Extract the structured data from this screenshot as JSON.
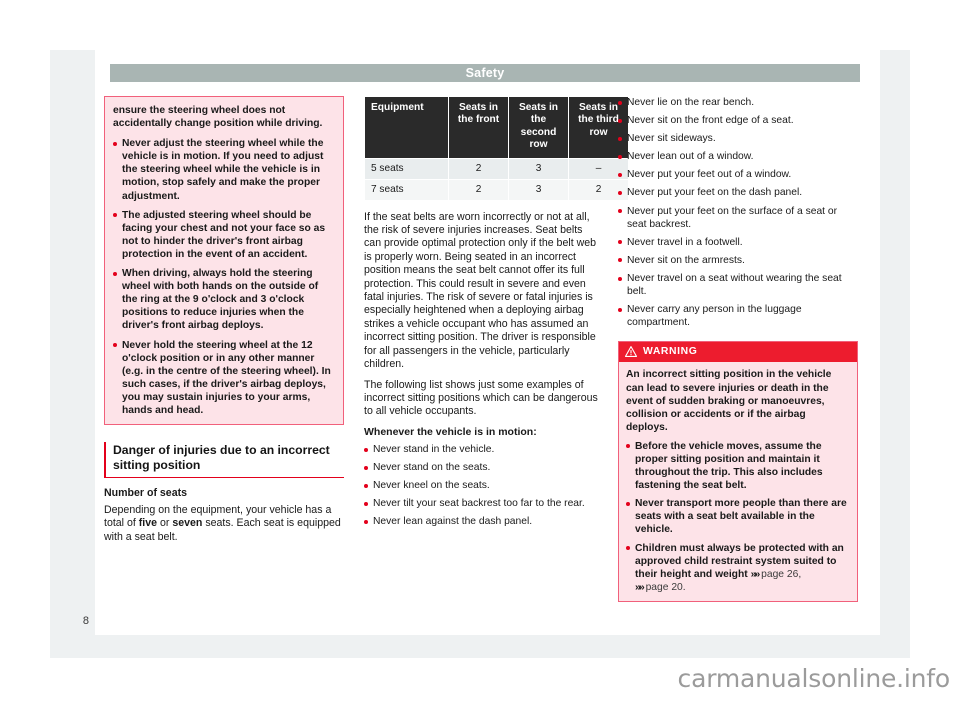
{
  "header": {
    "title": "Safety"
  },
  "page_number": "8",
  "watermark": "carmanualsonline.info",
  "left_column": {
    "danger_box": {
      "intro": "ensure the steering wheel does not accidentally change position while driving.",
      "bullets": [
        "Never adjust the steering wheel while the vehicle is in motion. If you need to adjust the steering wheel while the vehicle is in motion, stop safely and make the proper adjustment.",
        "The adjusted steering wheel should be facing your chest and not your face so as not to hinder the driver's front airbag protection in the event of an accident.",
        "When driving, always hold the steering wheel with both hands on the outside of the ring at the 9 o'clock and 3 o'clock positions to reduce injuries when the driver's front airbag deploys.",
        "Never hold the steering wheel at the 12 o'clock position or in any other manner (e.g. in the centre of the steering wheel). In such cases, if the driver's airbag deploys, you may sustain injuries to your arms, hands and head."
      ]
    },
    "section_heading": "Danger of injuries due to an incorrect sitting position",
    "sub_heading": "Number of seats",
    "paragraph_pre": "Depending on the equipment, your vehicle has a total of ",
    "paragraph_bold1": "five",
    "paragraph_mid": " or ",
    "paragraph_bold2": "seven",
    "paragraph_post": " seats. Each seat is equipped with a seat belt."
  },
  "middle_column": {
    "table": {
      "headers": [
        "Equipment",
        "Seats in the front",
        "Seats in the second row",
        "Seats in the third row"
      ],
      "rows": [
        [
          "5 seats",
          "2",
          "3",
          "–"
        ],
        [
          "7 seats",
          "2",
          "3",
          "2"
        ]
      ]
    },
    "paragraph1": "If the seat belts are worn incorrectly or not at all, the risk of severe injuries increases. Seat belts can provide optimal protection only if the belt web is properly worn. Being seated in an incorrect position means the seat belt cannot offer its full protection. This could result in severe and even fatal injuries. The risk of severe or fatal injuries is especially heightened when a deploying airbag strikes a vehicle occupant who has assumed an incorrect sitting position. The driver is responsible for all passengers in the vehicle, particularly children.",
    "paragraph2": "The following list shows just some examples of incorrect sitting positions which can be dangerous to all vehicle occupants.",
    "list_heading": "Whenever the vehicle is in motion:",
    "bullets": [
      "Never stand in the vehicle.",
      "Never stand on the seats.",
      "Never kneel on the seats.",
      "Never tilt your seat backrest too far to the rear.",
      "Never lean against the dash panel."
    ]
  },
  "right_column": {
    "bullets": [
      "Never lie on the rear bench.",
      "Never sit on the front edge of a seat.",
      "Never sit sideways.",
      "Never lean out of a window.",
      "Never put your feet out of a window.",
      "Never put your feet on the dash panel.",
      "Never put your feet on the surface of a seat or seat backrest.",
      "Never travel in a footwell.",
      "Never sit on the armrests.",
      "Never travel on a seat without wearing the seat belt.",
      "Never carry any person in the luggage compartment."
    ],
    "warning": {
      "label": "WARNING",
      "intro": "An incorrect sitting position in the vehicle can lead to severe injuries or death in the event of sudden braking or manoeuvres, collision or accidents or if the airbag deploys.",
      "bullets": [
        "Before the vehicle moves, assume the proper sitting position and maintain it throughout the trip. This also includes fastening the seat belt.",
        "Never transport more people than there are seats with a seat belt available in the vehicle."
      ],
      "last_bullet_text": "Children must always be protected with an approved child restraint system suited to their height and weight ",
      "ref_chevron": "»»",
      "ref1": "page 26,",
      "ref2": "page 20."
    }
  },
  "colors": {
    "accent_red": "#e3001b",
    "warning_red": "#ed1c2e",
    "pink_fill": "#fde3e8",
    "pink_border": "#f1607b",
    "header_grey": "#a9b5b3",
    "mat_grey": "#eef1f2",
    "table_header": "#2a2a2a"
  }
}
